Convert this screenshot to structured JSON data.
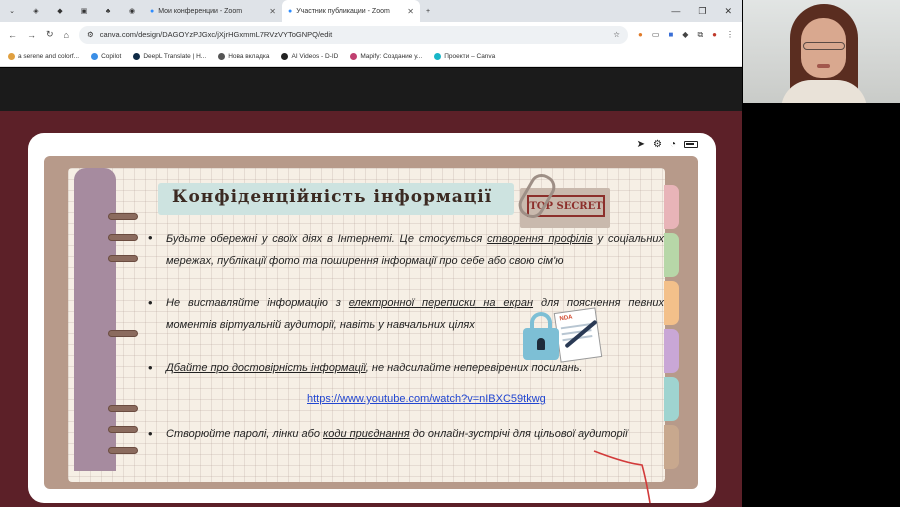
{
  "browser": {
    "tabs": [
      {
        "label": "Мои конференции - Zoom"
      },
      {
        "label": "Участник публикации - Zoom"
      }
    ],
    "url": "canva.com/design/DAGOYzPJGxc/jXjrHGxmmL7RVzVYToGNPQ/edit",
    "bookmarks": [
      {
        "label": "a serene and colorf...",
        "color": "#e0a040"
      },
      {
        "label": "Copilot",
        "color": "#3a8ee6"
      },
      {
        "label": "DeepL Translate | Н...",
        "color": "#0f2b46"
      },
      {
        "label": "Нова вкладка",
        "color": "#555555"
      },
      {
        "label": "AI Videos - D-ID",
        "color": "#222222"
      },
      {
        "label": "Mapify: Создание у...",
        "color": "#c04070"
      },
      {
        "label": "Проекти – Canva",
        "color": "#19b6c8"
      }
    ]
  },
  "slide": {
    "title": "Конфіденційність інформації",
    "stamp": "TOP SECRET",
    "doc_label": "NDA",
    "bullets": [
      {
        "before": "Будьте обережні у своїх діях в Інтернеті. Це стосується ",
        "link": "створення профілів",
        "after": " у соціальних мережах, публікації фото та поширення інформації про себе або свою сім'ю"
      },
      {
        "before": "Не виставляйте інформацію з ",
        "link": "електронної переписки на екран",
        "after": " для пояснення певних моментів віртуальній аудиторії, навіть у навчальних цілях"
      },
      {
        "before": "",
        "link": "Дбайте про достовірність інформації",
        "after": ", не надсилайте неперевірених посилань."
      },
      {
        "before": "Створюйте паролі, лінки або ",
        "link": "коди приєднання",
        "after": " до онлайн-зустрічі для цільової аудиторії"
      }
    ],
    "video_url": "https://www.youtube.com/watch?v=nIBXC59tkwg"
  },
  "colors": {
    "stage": "#5c2028",
    "spine": "#a68b9f",
    "link": "#2246d0",
    "side_tabs": [
      "#e8b4b8",
      "#b7d7a8",
      "#f3c08a",
      "#c9a7d6",
      "#9fd4d0",
      "#c8a88e"
    ]
  }
}
